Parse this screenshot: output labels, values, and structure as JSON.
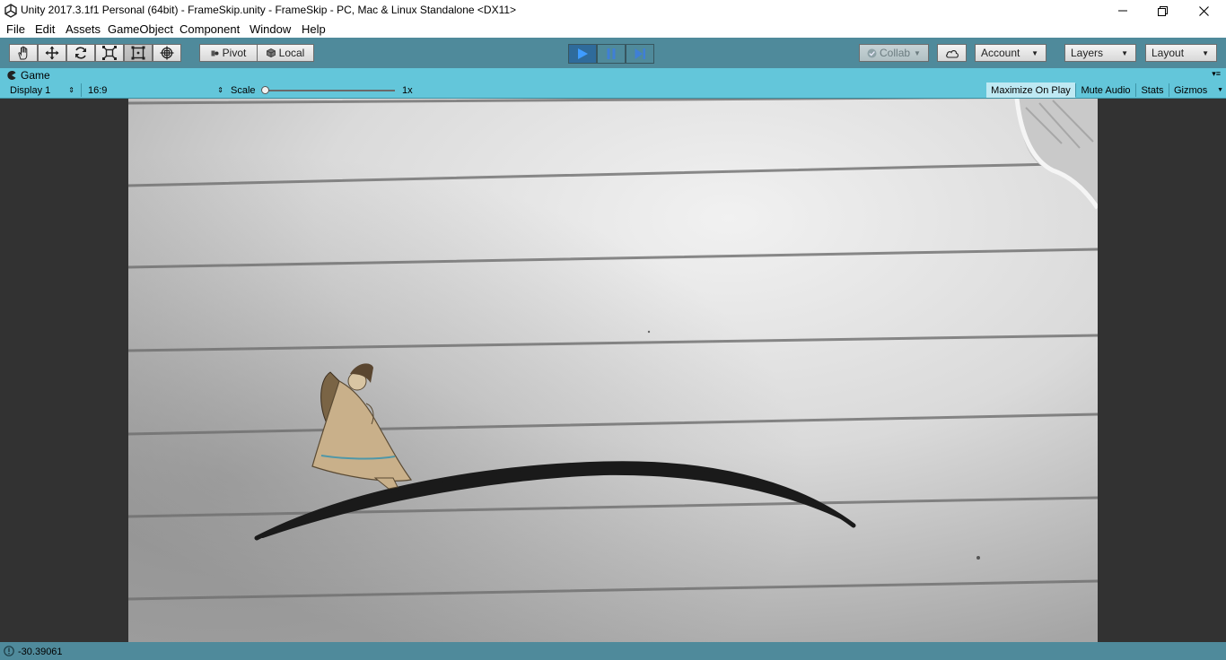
{
  "window": {
    "title": "Unity 2017.3.1f1 Personal (64bit) - FrameSkip.unity - FrameSkip - PC, Mac & Linux Standalone <DX11>"
  },
  "menu": {
    "items": [
      "File",
      "Edit",
      "Assets",
      "GameObject",
      "Component",
      "Window",
      "Help"
    ]
  },
  "toolbar": {
    "transform_tools": [
      "hand-icon",
      "move-icon",
      "rotate-icon",
      "scale-icon",
      "rect-icon",
      "transform-icon"
    ],
    "active_tool": "rect-icon",
    "pivot_label": "Pivot",
    "local_label": "Local",
    "play_state": "playing",
    "collab_label": "Collab",
    "account_label": "Account",
    "layers_label": "Layers",
    "layout_label": "Layout"
  },
  "game_tab": {
    "label": "Game",
    "display": "Display 1",
    "aspect": "16:9",
    "scale_label": "Scale",
    "scale_value": "1x",
    "scale_level": 0.0,
    "maximize_on_play": "Maximize On Play",
    "maximize_on_play_on": true,
    "mute_audio": "Mute Audio",
    "stats": "Stats",
    "gizmos": "Gizmos"
  },
  "status": {
    "message": "-30.39061"
  },
  "colors": {
    "toolbar_bg": "#4f8a9b",
    "tab_bg": "#63c6da",
    "play_active": "#3f7fd6",
    "viewport_bg": "#323232"
  }
}
